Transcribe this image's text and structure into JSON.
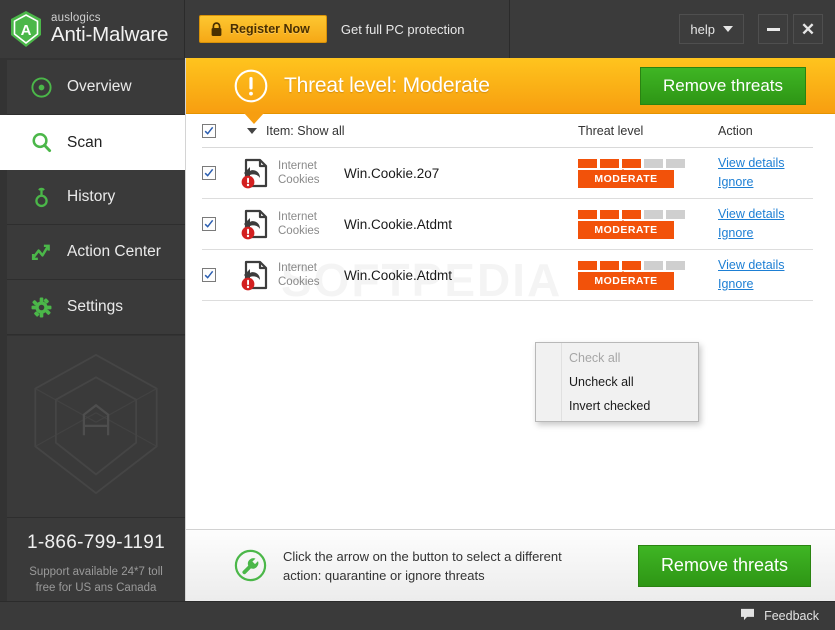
{
  "titlebar": {
    "brand_sub": "auslogics",
    "brand_main": "Anti-Malware",
    "brand_logo_icon": "shield-a-logo-icon",
    "register_label": "Register Now",
    "register_lock_icon": "lock-icon",
    "promo_text": "Get full PC protection",
    "help_label": "help",
    "help_caret_icon": "chevron-down-icon",
    "minimize_icon": "minimize-icon",
    "close_icon": "close-icon"
  },
  "sidebar": {
    "items": [
      {
        "label": "Overview",
        "icon": "target-icon",
        "active": false
      },
      {
        "label": "Scan",
        "icon": "magnifier-icon",
        "active": true
      },
      {
        "label": "History",
        "icon": "key-icon",
        "active": false
      },
      {
        "label": "Action Center",
        "icon": "activity-arrows-icon",
        "active": false
      },
      {
        "label": "Settings",
        "icon": "gear-icon",
        "active": false
      }
    ],
    "watermark_logo_icon": "shield-a-outline-icon",
    "support_phone": "1-866-799-1191",
    "support_note": "Support available 24*7 toll free for US ans Canada"
  },
  "banner": {
    "warning_icon": "exclamation-circle-icon",
    "title": "Threat level: Moderate",
    "remove_label": "Remove threats"
  },
  "watermark_text": "SOFTPEDIA",
  "table": {
    "select_all_checked": true,
    "filter_caret_icon": "caret-down-icon",
    "filter_label": "Item: Show all",
    "columns": {
      "threat_level": "Threat level",
      "action": "Action"
    },
    "rows": [
      {
        "checked": true,
        "icon": "cookie-file-alert-icon",
        "type": "Internet Cookies",
        "name": "Win.Cookie.2o7",
        "threat_filled": 3,
        "threat_total": 5,
        "threat_badge": "MODERATE",
        "view_details_label": "View details",
        "ignore_label": "Ignore"
      },
      {
        "checked": true,
        "icon": "cookie-file-alert-icon",
        "type": "Internet Cookies",
        "name": "Win.Cookie.Atdmt",
        "threat_filled": 3,
        "threat_total": 5,
        "threat_badge": "MODERATE",
        "view_details_label": "View details",
        "ignore_label": "Ignore"
      },
      {
        "checked": true,
        "icon": "cookie-file-alert-icon",
        "type": "Internet Cookies",
        "name": "Win.Cookie.Atdmt",
        "threat_filled": 3,
        "threat_total": 5,
        "threat_badge": "MODERATE",
        "view_details_label": "View details",
        "ignore_label": "Ignore"
      }
    ]
  },
  "context_menu": {
    "items": [
      {
        "label": "Check all",
        "disabled": true
      },
      {
        "label": "Uncheck all",
        "disabled": false
      },
      {
        "label": "Invert checked",
        "disabled": false
      }
    ]
  },
  "action_bar": {
    "icon": "wrench-circle-icon",
    "hint_line1": "Click the arrow on the button to select a different",
    "hint_line2": "action: quarantine or ignore threats",
    "remove_label": "Remove threats"
  },
  "footer": {
    "feedback_icon": "speech-bubble-icon",
    "feedback_label": "Feedback"
  },
  "colors": {
    "accent_green": "#3fb524",
    "brand_green": "#4bb749",
    "banner_orange": "#fbb317",
    "threat_orange": "#f2520a",
    "link_blue": "#1d7fd4",
    "dark_chrome": "#333333",
    "panel_dark": "#3a3a3a"
  }
}
